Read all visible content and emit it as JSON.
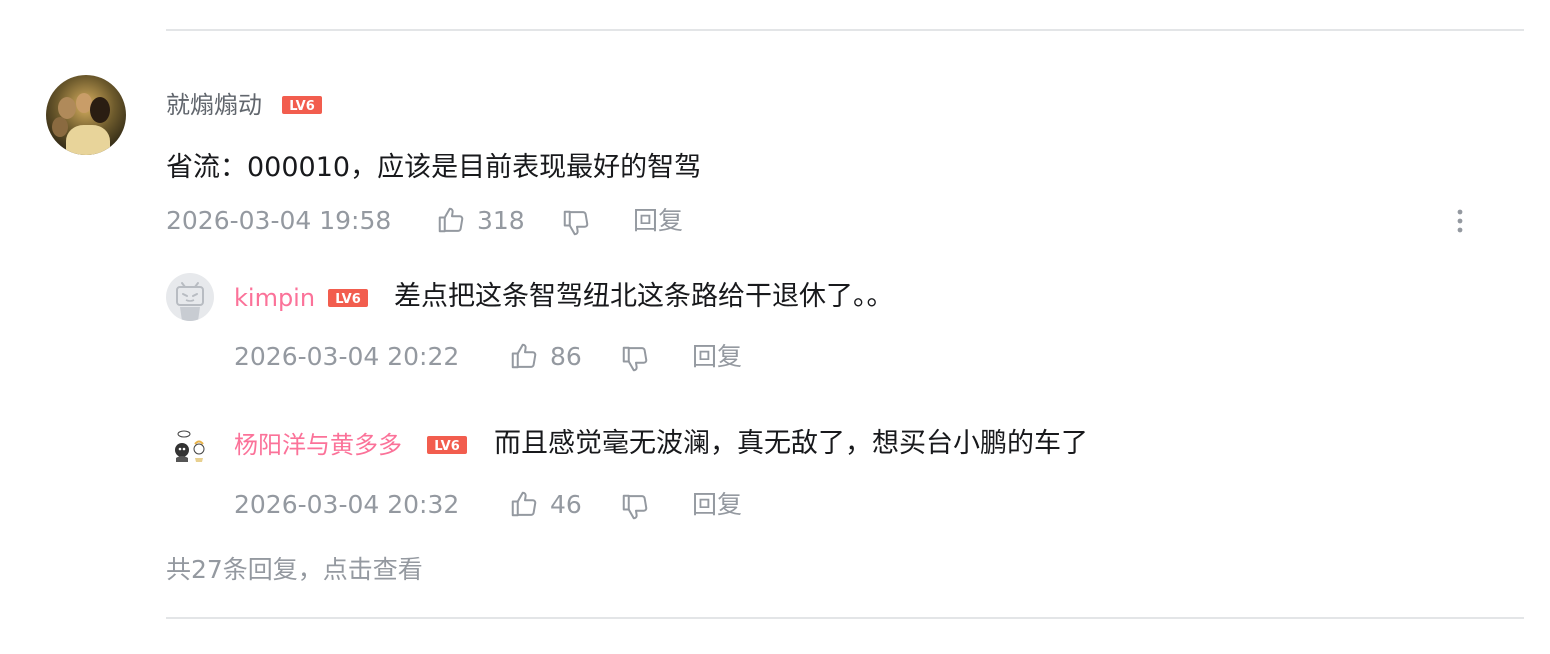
{
  "comment": {
    "username": "就煽煽动",
    "level": "LV6",
    "text": "省流：000010，应该是目前表现最好的智驾",
    "time": "2026-03-04 19:58",
    "likes": "318",
    "reply_label": "回复"
  },
  "replies": [
    {
      "username": "kimpin",
      "level": "LV6",
      "text": "差点把这条智驾纽北这条路给干退休了。。",
      "time": "2026-03-04 20:22",
      "likes": "86",
      "reply_label": "回复"
    },
    {
      "username": "杨阳洋与黄多多",
      "level": "LV6",
      "text": "而且感觉毫无波澜，真无敌了，想买台小鹏的车了",
      "time": "2026-03-04 20:32",
      "likes": "46",
      "reply_label": "回复"
    }
  ],
  "view_more": "共27条回复，点击查看",
  "colors": {
    "pink_username": "#fb7299",
    "gray_username": "#61666d",
    "level_red": "#f25d4e",
    "meta_gray": "#9499a0",
    "divider": "#e3e5e7"
  }
}
